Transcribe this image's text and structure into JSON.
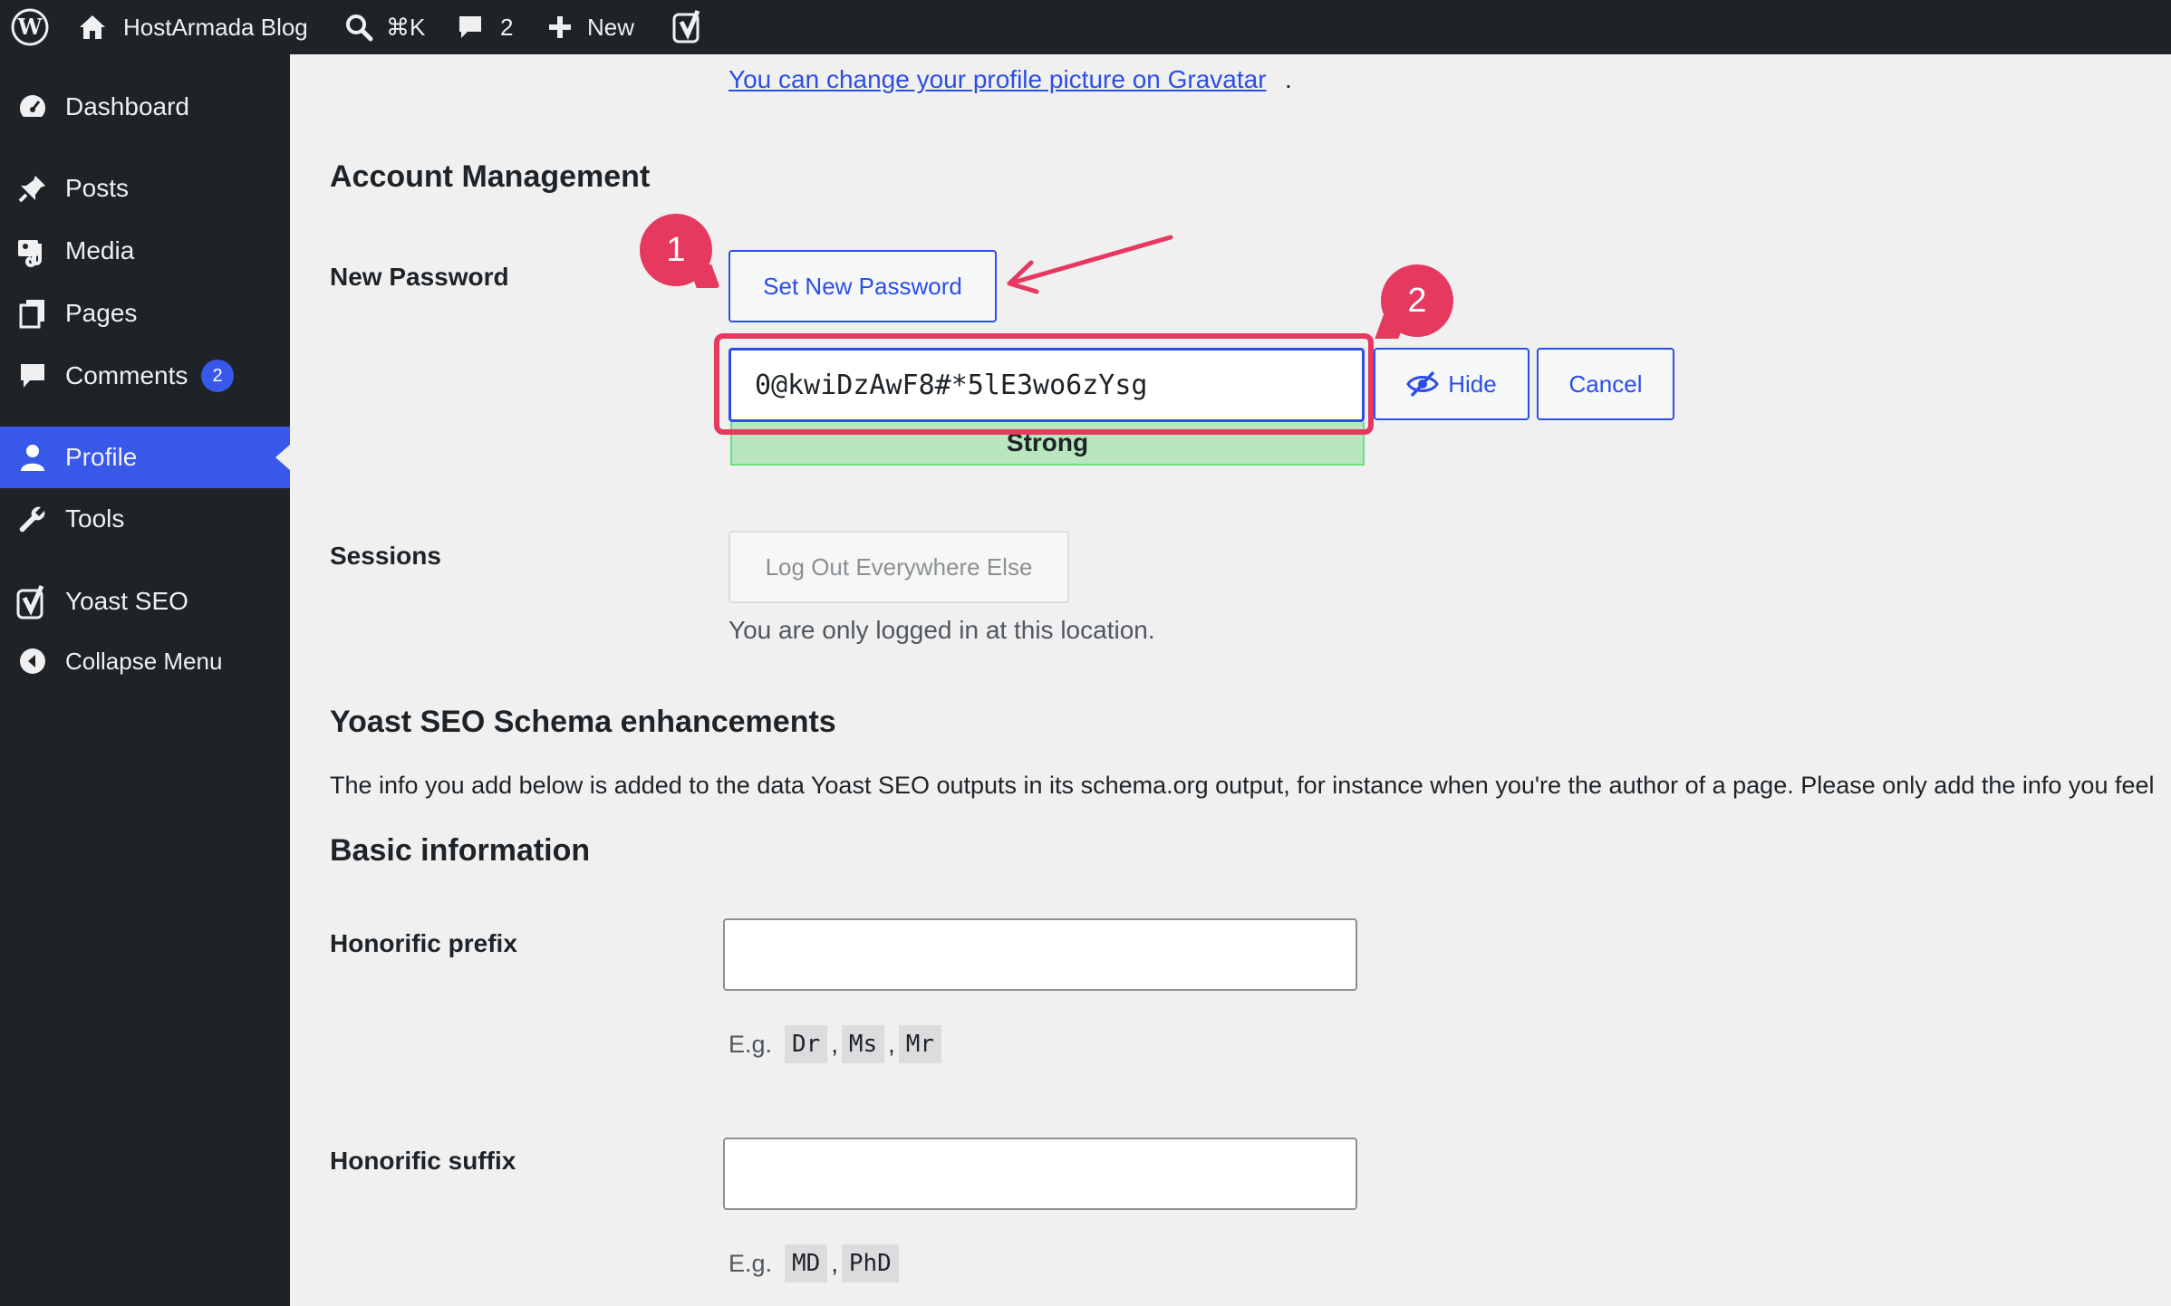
{
  "adminbar": {
    "site_name": "HostArmada Blog",
    "search_shortcut": "⌘K",
    "comments_count": "2",
    "new_label": "New"
  },
  "sidebar": {
    "items": [
      {
        "label": "Dashboard",
        "icon": "dashboard-icon"
      },
      {
        "label": "Posts",
        "icon": "pin-icon"
      },
      {
        "label": "Media",
        "icon": "media-icon"
      },
      {
        "label": "Pages",
        "icon": "pages-icon"
      },
      {
        "label": "Comments",
        "icon": "comment-icon",
        "badge": "2"
      },
      {
        "label": "Profile",
        "icon": "user-icon",
        "active": true
      },
      {
        "label": "Tools",
        "icon": "wrench-icon"
      },
      {
        "label": "Yoast SEO",
        "icon": "yoast-icon"
      },
      {
        "label": "Collapse Menu",
        "icon": "collapse-icon"
      }
    ]
  },
  "main": {
    "gravatar_link": "You can change your profile picture on Gravatar",
    "gravatar_dot": ".",
    "account_heading": "Account Management",
    "new_password_label": "New Password",
    "set_password_button": "Set New Password",
    "password_value": "0@kwiDzAwF8#*5lE3wo6zYsg",
    "strength": "Strong",
    "hide_button": "Hide",
    "cancel_button": "Cancel",
    "sessions_label": "Sessions",
    "logout_button": "Log Out Everywhere Else",
    "sessions_desc": "You are only logged in at this location.",
    "schema_heading": "Yoast SEO Schema enhancements",
    "schema_intro": "The info you add below is added to the data Yoast SEO outputs in its schema.org output, for instance when you're the author of a page. Please only add the info you feel",
    "basic_heading": "Basic information",
    "prefix_label": "Honorific prefix",
    "prefix_eg": "E.g.",
    "prefix_examples": [
      "Dr",
      "Ms",
      "Mr"
    ],
    "suffix_label": "Honorific suffix",
    "suffix_eg": "E.g.",
    "suffix_examples": [
      "MD",
      "PhD"
    ],
    "comma": ","
  },
  "annotations": {
    "marker_1": "1",
    "marker_2": "2",
    "color": "#e6395f"
  },
  "colors": {
    "accent": "#2c4ee5",
    "sidebar_bg": "#1d2327",
    "active_menu": "#3858e9",
    "strength_bg": "#b8e6bf"
  }
}
